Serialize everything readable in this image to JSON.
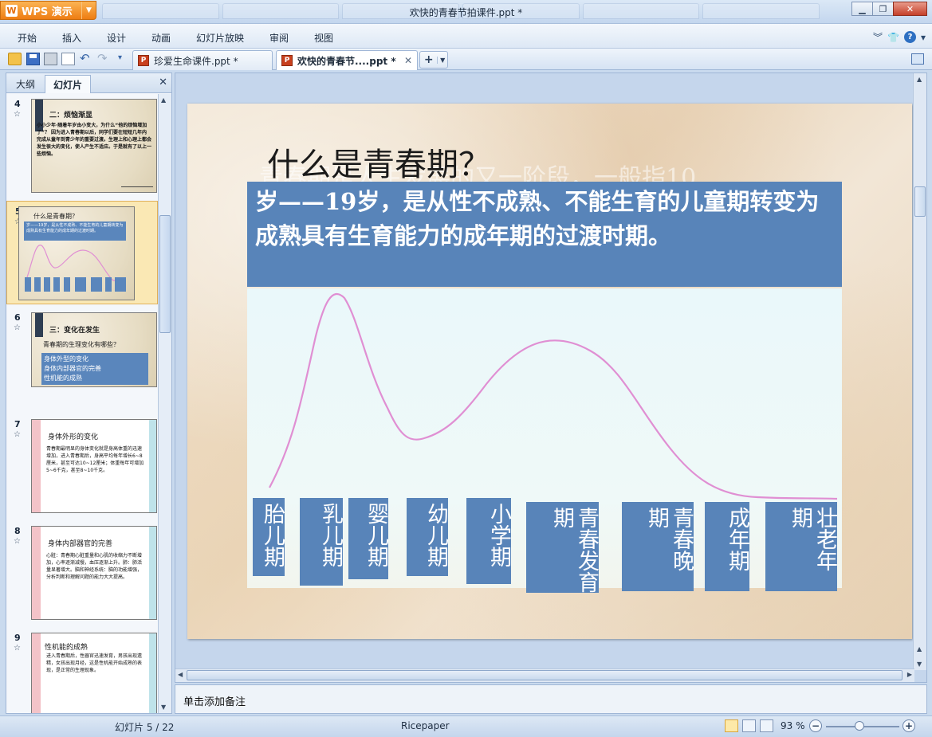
{
  "app": {
    "button_label": "WPS 演示",
    "window_title": "欢快的青春节拍课件.ppt *"
  },
  "menu": [
    "开始",
    "插入",
    "设计",
    "动画",
    "幻灯片放映",
    "审阅",
    "视图"
  ],
  "doc_tabs": [
    {
      "label": "珍爱生命课件.ppt *",
      "active": false
    },
    {
      "label": "欢快的青春节....ppt *",
      "active": true
    }
  ],
  "left_panel": {
    "tabs": [
      "大纲",
      "幻灯片"
    ],
    "active_tab": "幻灯片",
    "thumbnails": [
      {
        "num": "4",
        "title": "二：烦恼渐显",
        "body": "小小少年·随着年岁由小变大，为什么“他的烦恼增加了”？ 因为进入青春期以后，同学们要在短短几年内完成从童年到青少年的重要过渡。生理上和心理上都会发生很大的变化，使人产生不适应。于是就有了以上一些烦恼。"
      },
      {
        "num": "5",
        "title": "什么是青春期？",
        "body": "岁——19岁，是从性不成熟、不能生育的儿童期转变为成熟具有生育能力的成年期的过渡时期。"
      },
      {
        "num": "6",
        "title": "三：变化在发生",
        "sub": "青春期的生理变化有哪些？",
        "items": [
          "身体外型的变化",
          "身体内部器官的完善",
          "性机能的成熟"
        ]
      },
      {
        "num": "7",
        "title": "身体外形的变化",
        "body": "青春期最明显的身体变化就是身高体重的迅速增加，进入青春期后，身高平均每年增长6~8厘米，甚至可达10~12厘米；体重每年可增加5~6千克，甚至8~10千克。"
      },
      {
        "num": "8",
        "title": "身体内部器官的完善",
        "body": "心脏：青春期心脏重量和心肌的收缩力不断增加，心率逐渐减慢，血压逐渐上升。肺：肺活量显著增大。脑和神经系统：脑的功能增强，分析判断和理解问题的能力大大提高。"
      },
      {
        "num": "9",
        "title": "性机能的成熟",
        "body": "进入青春期后，性器官迅速发育，男孩出现遗精，女孩出现月经，这是性机能开始成熟的表现，是正常的生理现象。"
      }
    ]
  },
  "slide": {
    "title": "什么是青春期？",
    "ghost_text": "青春期是人生发展的又一阶段，一般指10",
    "definition": "岁——19岁，是从性不成熟、不能生育的儿童期转变为成熟具有生育能力的成年期的过渡时期。",
    "stages": [
      "胎儿期",
      "乳儿期",
      "婴儿期",
      "幼儿期",
      "小学期",
      "青春发育期",
      "青春晚期",
      "成年期",
      "壮老年期"
    ],
    "curve_color": "#e08fd3"
  },
  "notes": {
    "placeholder": "单击添加备注"
  },
  "status": {
    "slide_indicator": "幻灯片 5 / 22",
    "theme": "Ricepaper",
    "zoom": "93 %"
  }
}
